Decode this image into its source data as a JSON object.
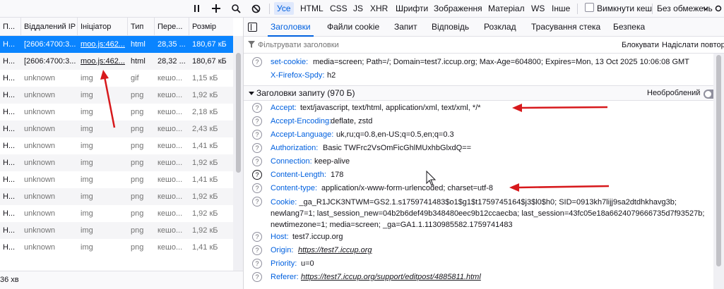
{
  "toolbar": {
    "filter_tabs": [
      "Усе",
      "HTML",
      "CSS",
      "JS",
      "XHR",
      "Шрифти",
      "Зображення",
      "Матеріал",
      "WS",
      "Інше"
    ],
    "disable_cache_label": "Вимкнути кеш",
    "throttle_label": "Без обмежень"
  },
  "table": {
    "headers": [
      "П...",
      "Віддалений IP",
      "Ініціатор",
      "Тип",
      "Пере...",
      "Розмір"
    ],
    "rows": [
      [
        "H...",
        "[2606:4700:3...",
        "moo.js:462...",
        "html",
        "28,35 ...",
        "180,67 кБ"
      ],
      [
        "H...",
        "[2606:4700:3...",
        "moo.js:462...",
        "html",
        "28,32 ...",
        "180,67 кБ"
      ],
      [
        "H...",
        "unknown",
        "img",
        "gif",
        "кешо...",
        "1,15 кБ"
      ],
      [
        "H...",
        "unknown",
        "img",
        "png",
        "кешо...",
        "1,92 кБ"
      ],
      [
        "H...",
        "unknown",
        "img",
        "png",
        "кешо...",
        "2,18 кБ"
      ],
      [
        "H...",
        "unknown",
        "img",
        "png",
        "кешо...",
        "2,43 кБ"
      ],
      [
        "H...",
        "unknown",
        "img",
        "png",
        "кешо...",
        "1,41 кБ"
      ],
      [
        "H...",
        "unknown",
        "img",
        "png",
        "кешо...",
        "1,92 кБ"
      ],
      [
        "H...",
        "unknown",
        "img",
        "png",
        "кешо...",
        "1,41 кБ"
      ],
      [
        "H...",
        "unknown",
        "img",
        "png",
        "кешо...",
        "1,92 кБ"
      ],
      [
        "H...",
        "unknown",
        "img",
        "png",
        "кешо...",
        "1,92 кБ"
      ],
      [
        "H...",
        "unknown",
        "img",
        "png",
        "кешо...",
        "1,92 кБ"
      ],
      [
        "H...",
        "unknown",
        "img",
        "png",
        "кешо...",
        "1,41 кБ"
      ]
    ],
    "status_text": "36 хв"
  },
  "details": {
    "tabs": [
      "Заголовки",
      "Файли cookie",
      "Запит",
      "Відповідь",
      "Розклад",
      "Трасування стека",
      "Безпека"
    ],
    "filter_placeholder": "Фільтрувати заголовки",
    "block_label": "Блокувати",
    "resend_label": "Надіслати повтор",
    "response_headers": [
      {
        "name": "set-cookie:",
        "value": "media=screen; Path=/; Domain=test7.iccup.org; Max-Age=604800; Expires=Mon, 13 Oct 2025 10:06:08 GMT"
      },
      {
        "name": "X-Firefox-Spdy:",
        "value": "h2"
      }
    ],
    "request_section_title": "Заголовки запиту (970 Б)",
    "raw_label": "Необроблений",
    "request_headers": [
      {
        "name": "Accept:",
        "value": "text/javascript, text/html, application/xml, text/xml, */*"
      },
      {
        "name": "Accept-Encoding:",
        "value": "deflate, zstd"
      },
      {
        "name": "Accept-Language:",
        "value": "uk,ru;q=0.8,en-US;q=0.5,en;q=0.3"
      },
      {
        "name": "Authorization:",
        "value": "Basic TWFrc2VsOmFicGhlMUxhbGlxdQ=="
      },
      {
        "name": "Connection:",
        "value": "keep-alive"
      },
      {
        "name": "Content-Length:",
        "value": "178"
      },
      {
        "name": "Content-type:",
        "value": "application/x-www-form-urlencoded; charset=utf-8"
      }
    ],
    "cookie": {
      "name": "Cookie:",
      "value": "_ga_R1JCK3NTWM=GS2.1.s1759741483$o1$g1$t1759745164$j3$l0$h0; SID=0913kh7lijj9sa2dtdhkhavg3b; newlang7=1; last_session_new=04b2b6def49b348480eec9b12ccaecba; last_session=43fc05e18a6624079666735d7f93527b; newtimezone=1; media=screen; _ga=GA1.1.1130985582.1759741483"
    },
    "request_headers_2": [
      {
        "name": "Host:",
        "value": "test7.iccup.org",
        "link": false
      },
      {
        "name": "Origin:",
        "value": "https://test7.iccup.org",
        "link": true
      },
      {
        "name": "Priority:",
        "value": "u=0",
        "link": false
      },
      {
        "name": "Referer:",
        "value": "https://test7.iccup.org/support/editpost/4885811.html",
        "link": true
      }
    ]
  },
  "colors": {
    "accent": "#0060df",
    "selected_row": "#0a84ff",
    "annotation_arrow": "#d7191c"
  },
  "icons": [
    "pause-icon",
    "add-icon",
    "search-icon",
    "block-icon",
    "sidebar-toggle-icon",
    "filter-icon",
    "help-icon",
    "cursor-icon"
  ]
}
